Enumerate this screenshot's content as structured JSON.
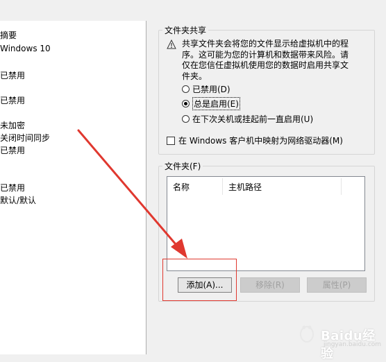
{
  "left_panel": {
    "items": [
      "摘要",
      "Windows 10",
      "已禁用",
      "已禁用",
      "未加密",
      "关闭时间同步",
      "已禁用",
      "已禁用",
      "默认/默认"
    ]
  },
  "sharing": {
    "title": "文件夹共享",
    "warning": "共享文件夹会将您的文件显示给虚拟机中的程序。这可能为您的计算机和数据带来风险。请仅在您信任虚拟机使用您的数据时启用共享文件夹。",
    "options": [
      "已禁用(D)",
      "总是启用(E)",
      "在下次关机或挂起前一直启用(U)"
    ],
    "selected_index": 1,
    "map_drive_label": "在 Windows 客户机中映射为网络驱动器(M)"
  },
  "folders": {
    "title": "文件夹(F)",
    "columns": [
      "名称",
      "主机路径"
    ],
    "add_label": "添加(A)...",
    "remove_label": "移除(R)",
    "properties_label": "属性(P)"
  },
  "watermark": {
    "brand": "Baidu经验",
    "url": "jingyan.baidu.com"
  },
  "colors": {
    "annotation": "#e0382f",
    "window_bg": "#f0f0f0"
  }
}
